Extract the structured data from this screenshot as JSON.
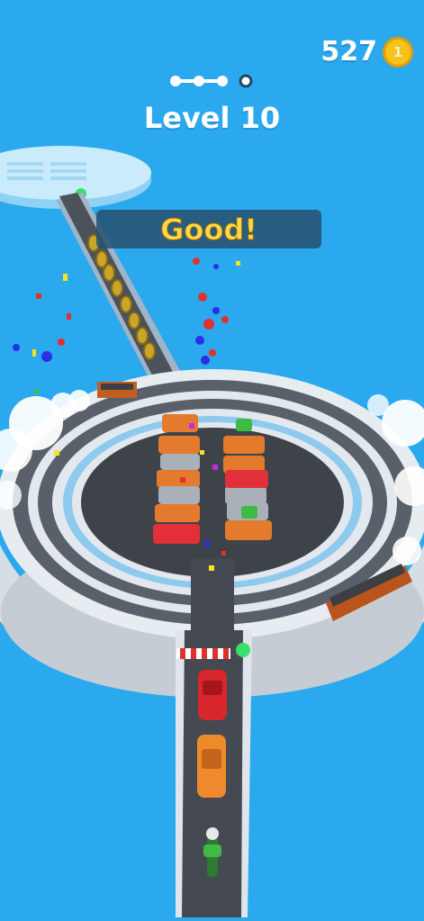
{
  "hud": {
    "coin_count": "527",
    "coin_symbol": "1",
    "level_label": "Level 10",
    "stage_progress": {
      "completed": 3,
      "total": 4
    }
  },
  "banner": {
    "text": "Good!"
  },
  "colors": {
    "sky": "#2aa9ee",
    "coin": "#f6c21c",
    "banner_bg": "#2a506e",
    "banner_text": "#ffd84a",
    "road": "#454a52",
    "platform": "#e6ebf0"
  }
}
